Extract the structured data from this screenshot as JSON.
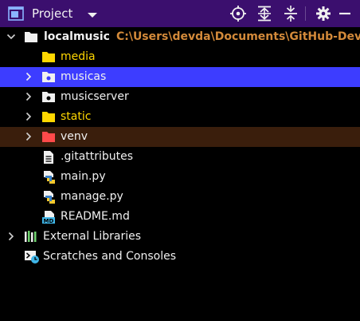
{
  "header": {
    "title": "Project",
    "bg_color": "#3b0f6e",
    "tools": [
      "locate-icon",
      "expand-all-icon",
      "collapse-all-icon",
      "gear-icon",
      "minimize-icon"
    ]
  },
  "tree": {
    "root": {
      "name": "localmusic",
      "path": "C:\\Users\\devda\\Documents\\GitHub-DevDaniel\\l"
    },
    "items": [
      {
        "name": "media",
        "kind": "folder",
        "color": "yellow"
      },
      {
        "name": "musicas",
        "kind": "package",
        "selected": true
      },
      {
        "name": "musicserver",
        "kind": "package"
      },
      {
        "name": "static",
        "kind": "folder",
        "color": "yellow"
      },
      {
        "name": "venv",
        "kind": "excluded-folder"
      },
      {
        "name": ".gitattributes",
        "kind": "text-file"
      },
      {
        "name": "main.py",
        "kind": "python-file"
      },
      {
        "name": "manage.py",
        "kind": "python-file"
      },
      {
        "name": "README.md",
        "kind": "markdown-file"
      }
    ],
    "external_libraries": "External Libraries",
    "scratches": "Scratches and Consoles"
  },
  "colors": {
    "selection": "#3d3dff",
    "excluded_row": "#3a1e0c",
    "path": "#d38a3a",
    "yellow_folder": "#ffd700"
  }
}
